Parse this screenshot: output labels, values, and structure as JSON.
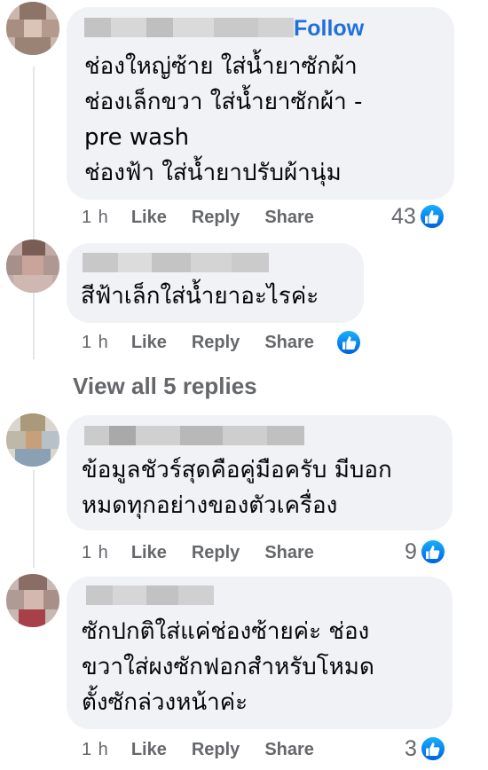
{
  "colors": {
    "accent": "#216fdb",
    "bubble": "#f0f2f5",
    "meta": "#65676b",
    "like": "#0866ff"
  },
  "comments": [
    {
      "follow_label": "Follow",
      "text": "ช่องใหญ่ซ้าย ใส่น้ำยาซักผ้า\nช่องเล็กขวา ใส่น้ำยาซักผ้า -\npre wash\nช่องฟ้า ใส่น้ำยาปรับผ้านุ่ม",
      "time": "1 h",
      "like": "Like",
      "reply": "Reply",
      "share": "Share",
      "reaction_count": "43",
      "reaction_icon": "like-icon"
    },
    {
      "text": "สีฟ้าเล็กใส่น้ำยาอะไรค่ะ",
      "time": "1 h",
      "like": "Like",
      "reply": "Reply",
      "share": "Share",
      "reaction_count": "",
      "reaction_icon": "like-icon"
    },
    {
      "text": "ข้อมูลชัวร์สุดคือคู่มือครับ มีบอก\nหมดทุกอย่างของตัวเครื่อง",
      "time": "1 h",
      "like": "Like",
      "reply": "Reply",
      "share": "Share",
      "reaction_count": "9",
      "reaction_icon": "like-icon"
    },
    {
      "text": "ซักปกติใส่แค่ช่องซ้ายค่ะ ช่อง\nขวาใส่ผงซักฟอกสำหรับโหมด\nตั้งซักล่วงหน้าค่ะ",
      "time": "1 h",
      "like": "Like",
      "reply": "Reply",
      "share": "Share",
      "reaction_count": "3",
      "reaction_icon": "like-icon"
    }
  ],
  "view_replies": "View all 5 replies"
}
